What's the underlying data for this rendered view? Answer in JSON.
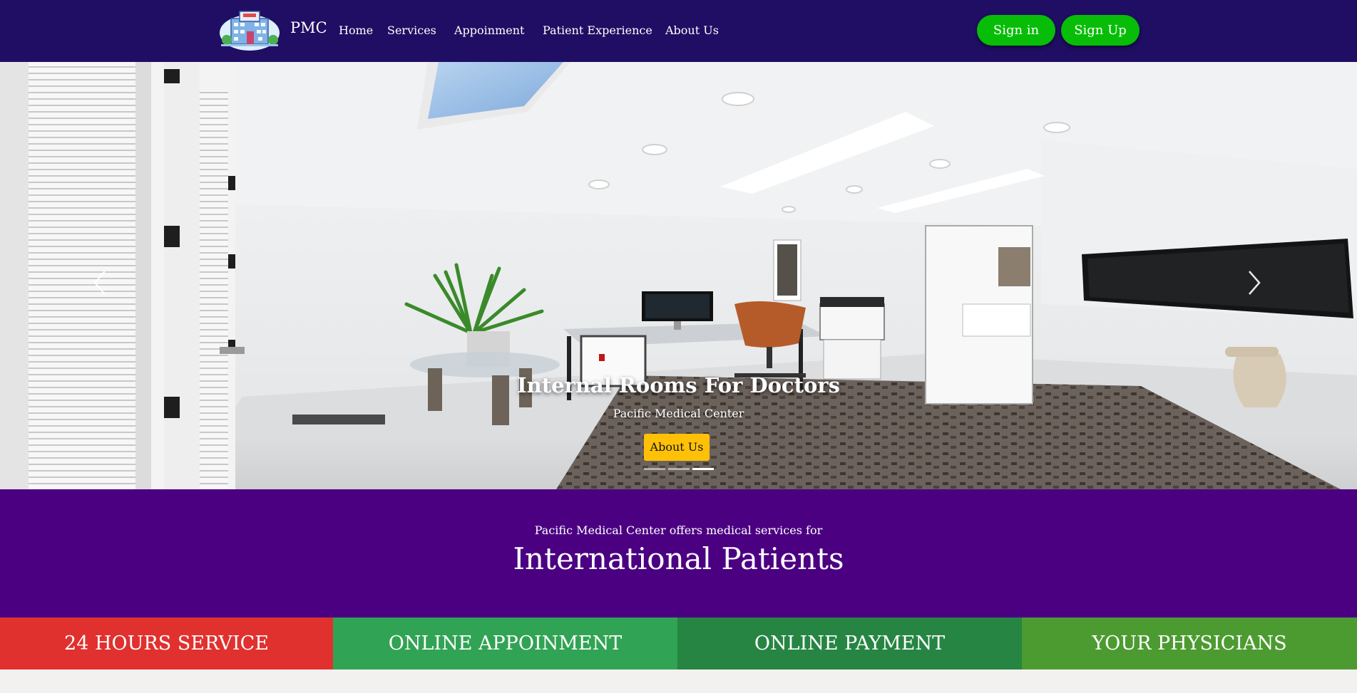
{
  "nav": {
    "brand": "PMC",
    "links": [
      "Home",
      "Services",
      "Appoinment",
      "Patient Experience",
      "About Us"
    ],
    "sign_in": "Sign in",
    "sign_up": "Sign Up"
  },
  "hero": {
    "title": "Internal Rooms For Doctors",
    "subtitle": "Pacific Medical Center",
    "button": "About Us",
    "active_slide": 3,
    "slide_count": 3
  },
  "intro": {
    "subtitle": "Pacific Medical Center offers medical services for",
    "title": "International Patients"
  },
  "features": [
    {
      "label": "24 HOURS SERVICE",
      "color": "#e0312f"
    },
    {
      "label": "ONLINE APPOINMENT",
      "color": "#31a354"
    },
    {
      "label": "ONLINE PAYMENT",
      "color": "#268543"
    },
    {
      "label": "YOUR PHYSICIANS",
      "color": "#4c9b31"
    }
  ],
  "colors": {
    "navbar": "#1f0e63",
    "intro": "#4b0082",
    "green_button": "#07bd07",
    "about_button": "#ffc107"
  }
}
